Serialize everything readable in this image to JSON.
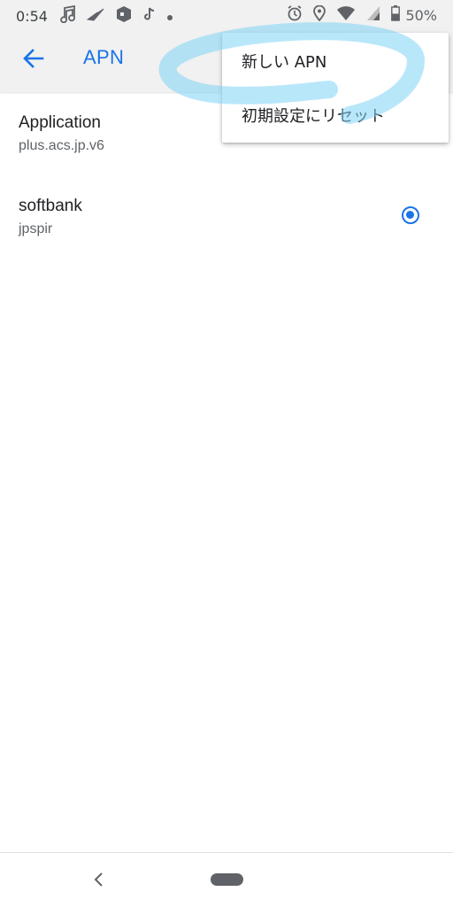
{
  "status_bar": {
    "time": "0:54",
    "battery": "50%",
    "icons": [
      "music-note-icon",
      "paper-plane-icon",
      "app-box-icon",
      "tiktok-icon",
      "dot-icon",
      "alarm-icon",
      "location-icon",
      "wifi-icon",
      "signal-icon",
      "battery-icon"
    ]
  },
  "app_bar": {
    "title": "APN",
    "back_icon": "arrow-back-icon"
  },
  "apn_list": [
    {
      "name": "Application",
      "value": "plus.acs.jp.v6",
      "selected": false
    },
    {
      "name": "softbank",
      "value": "jpspir",
      "selected": true
    }
  ],
  "menu": {
    "items": [
      {
        "label": "新しい APN"
      },
      {
        "label": "初期設定にリセット"
      }
    ]
  },
  "nav_bar": {
    "back_icon": "nav-back-icon",
    "home_icon": "home-pill-icon"
  },
  "colors": {
    "accent": "#1a73e8",
    "bar_bg": "#f1f1f1",
    "gesture": "#7fd3f5"
  }
}
